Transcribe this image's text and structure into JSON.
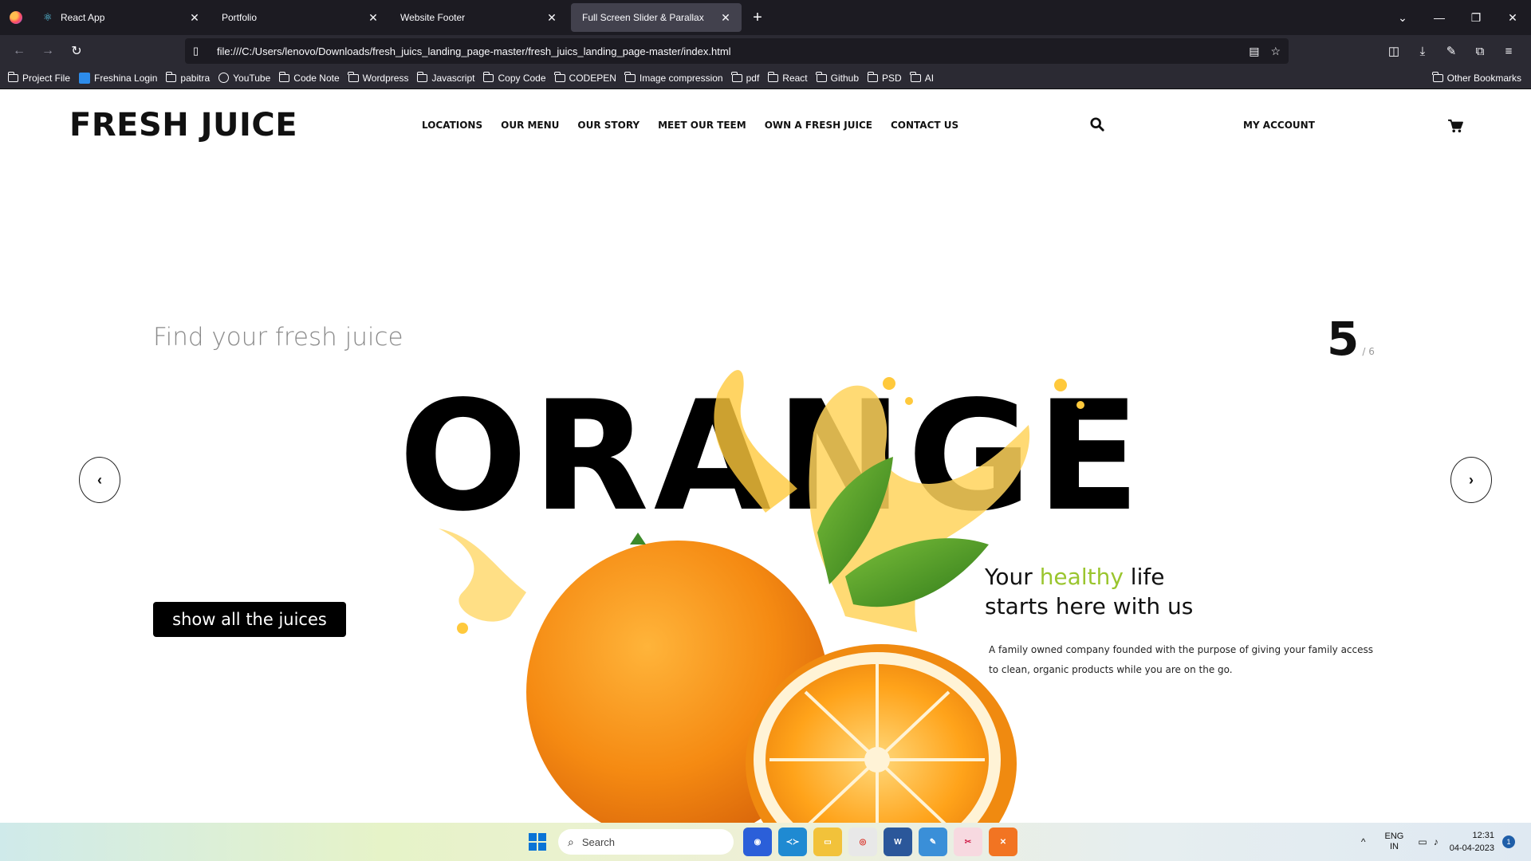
{
  "browser": {
    "tabs": [
      {
        "label": "React App",
        "active": false
      },
      {
        "label": "Portfolio",
        "active": false
      },
      {
        "label": "Website Footer",
        "active": false
      },
      {
        "label": "Full Screen Slider & Parallax",
        "active": true
      }
    ],
    "url": "file:///C:/Users/lenovo/Downloads/fresh_juics_landing_page-master/fresh_juics_landing_page-master/index.html",
    "bookmarks": [
      "Project File",
      "Freshina Login",
      "pabitra",
      "YouTube",
      "Code Note",
      "Wordpress",
      "Javascript",
      "Copy Code",
      "CODEPEN",
      "Image compression",
      "pdf",
      "React",
      "Github",
      "PSD",
      "AI"
    ],
    "other_bookmarks": "Other Bookmarks"
  },
  "site": {
    "brand": "FRESH JUICE",
    "nav": [
      "LOCATIONS",
      "OUR MENU",
      "OUR STORY",
      "MEET OUR TEEM",
      "OWN A FRESH JUICE",
      "CONTACT US"
    ],
    "account": "MY ACCOUNT",
    "tagline": "Find your fresh juice",
    "counter_current": "5",
    "counter_total": "/ 6",
    "big_word": "ORANGE",
    "cta": "show all the juices",
    "headline_pre": "Your ",
    "headline_green": "healthy",
    "headline_post": " life",
    "headline_line2": "starts here with us",
    "description": "A family owned company founded with the purpose of giving your family access to clean, organic products while you are on the go.",
    "accent_color": "#9ac52e"
  },
  "taskbar": {
    "search_placeholder": "Search",
    "lang_line1": "ENG",
    "lang_line2": "IN",
    "time": "12:31",
    "date": "04-04-2023",
    "notifications": "1"
  }
}
